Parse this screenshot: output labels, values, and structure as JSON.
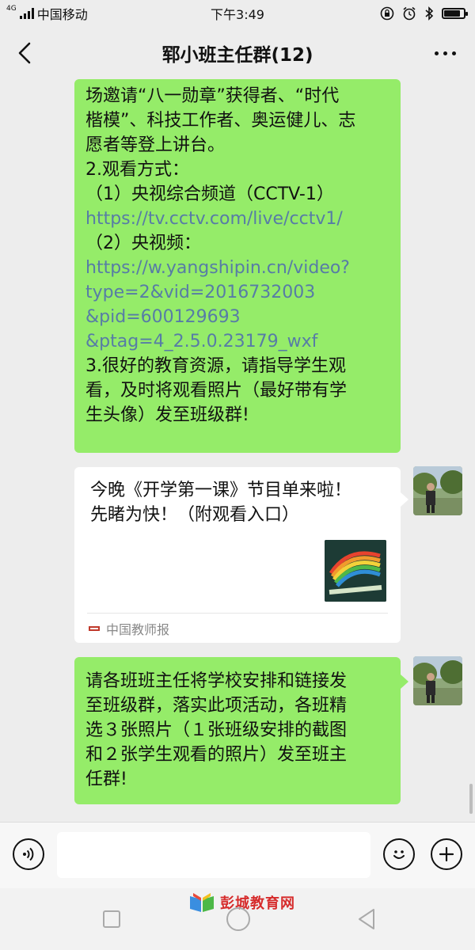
{
  "status_bar": {
    "network_type": "4G",
    "carrier": "中国移动",
    "time": "下午3:49",
    "battery_level": 0.85,
    "icons": [
      "lock-rotation-icon",
      "alarm-icon",
      "bluetooth-icon",
      "battery-icon"
    ]
  },
  "header": {
    "title": "郓小班主任群(12)",
    "back_icon": "chevron-left-icon",
    "more_icon": "more-dots-icon"
  },
  "messages": {
    "msg1": {
      "lines": [
        {
          "text": "场邀请“八一勋章”获得者、“时代",
          "link": false
        },
        {
          "text": "楷模”、科技工作者、奥运健儿、志",
          "link": false
        },
        {
          "text": "愿者等登上讲台。",
          "link": false
        },
        {
          "text": "2.观看方式：",
          "link": false
        },
        {
          "text": "（1）央视综合频道（CCTV-1）",
          "link": false
        },
        {
          "text": "https://tv.cctv.com/live/cctv1/",
          "link": true
        },
        {
          "text": "（2）央视频：",
          "link": false
        },
        {
          "text": "https://w.yangshipin.cn/video?",
          "link": true
        },
        {
          "text": "type=2&vid=2016732003",
          "link": true
        },
        {
          "text": "&pid=600129693",
          "link": true
        },
        {
          "text": "&ptag=4_2.5.0.23179_wxf",
          "link": true
        },
        {
          "text": "3.很好的教育资源，请指导学生观",
          "link": false
        },
        {
          "text": "看，及时将观看照片（最好带有学",
          "link": false
        },
        {
          "text": "生头像）发至班级群!",
          "link": false
        }
      ]
    },
    "card": {
      "line1": "今晚《开学第一课》节目单来啦！",
      "line2": "先睹为快！（附观看入口）",
      "source": "中国教师报"
    },
    "msg3": {
      "lines": [
        "请各班班主任将学校安排和链接发",
        "至班级群，落实此项活动，各班精",
        "选３张照片（１张班级安排的截图",
        "和２张学生观看的照片）发至班主",
        "任群!"
      ]
    }
  },
  "input_bar": {
    "placeholder": "",
    "voice_icon": "voice-icon",
    "emoji_icon": "emoji-icon",
    "plus_icon": "plus-icon"
  },
  "watermark": {
    "text": "彭城教育网"
  },
  "colors": {
    "bubble_green": "#95ec69",
    "link_blue": "#577ca6",
    "background": "#ededed"
  }
}
